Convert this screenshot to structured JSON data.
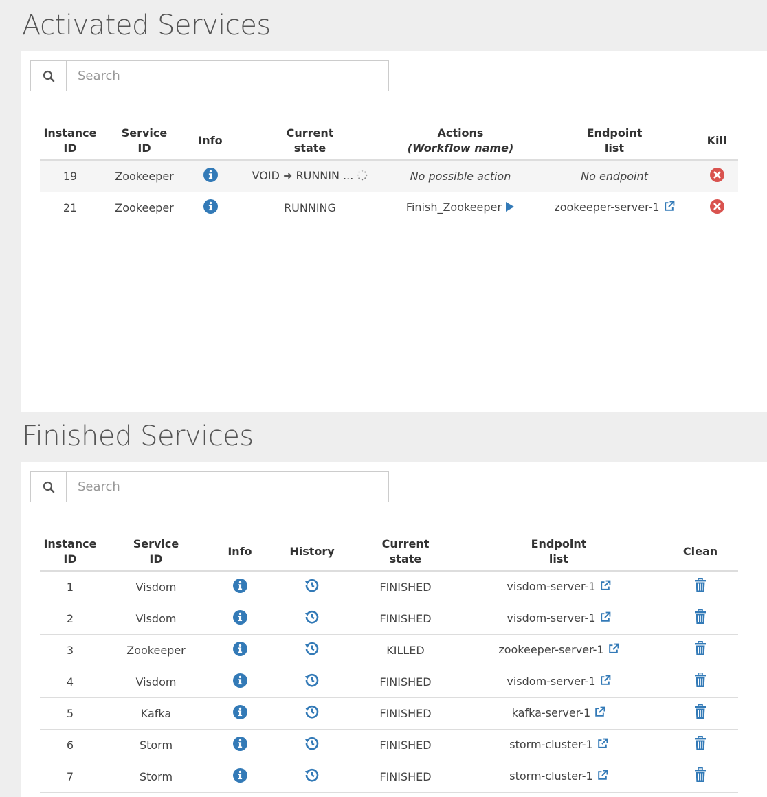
{
  "activated": {
    "title": "Activated Services",
    "search_placeholder": "Search",
    "headers": {
      "instance_1": "Instance",
      "instance_2": "ID",
      "service_1": "Service",
      "service_2": "ID",
      "info": "Info",
      "state_1": "Current",
      "state_2": "state",
      "actions_1": "Actions",
      "actions_2": "(Workflow name)",
      "endpoint_1": "Endpoint",
      "endpoint_2": "list",
      "kill": "Kill"
    },
    "rows": [
      {
        "instance_id": "19",
        "service_id": "Zookeeper",
        "state_from": "VOID",
        "state_arrow": "➜",
        "state_to": "RUNNIN ...",
        "action": "No possible action",
        "endpoint": "No endpoint"
      },
      {
        "instance_id": "21",
        "service_id": "Zookeeper",
        "state": "RUNNING",
        "action": "Finish_Zookeeper",
        "endpoint": "zookeeper-server-1"
      }
    ]
  },
  "finished": {
    "title": "Finished Services",
    "search_placeholder": "Search",
    "headers": {
      "instance_1": "Instance",
      "instance_2": "ID",
      "service_1": "Service",
      "service_2": "ID",
      "info": "Info",
      "history": "History",
      "state_1": "Current",
      "state_2": "state",
      "endpoint_1": "Endpoint",
      "endpoint_2": "list",
      "clean": "Clean"
    },
    "rows": [
      {
        "instance_id": "1",
        "service_id": "Visdom",
        "state": "FINISHED",
        "endpoint": "visdom-server-1"
      },
      {
        "instance_id": "2",
        "service_id": "Visdom",
        "state": "FINISHED",
        "endpoint": "visdom-server-1"
      },
      {
        "instance_id": "3",
        "service_id": "Zookeeper",
        "state": "KILLED",
        "endpoint": "zookeeper-server-1"
      },
      {
        "instance_id": "4",
        "service_id": "Visdom",
        "state": "FINISHED",
        "endpoint": "visdom-server-1"
      },
      {
        "instance_id": "5",
        "service_id": "Kafka",
        "state": "FINISHED",
        "endpoint": "kafka-server-1"
      },
      {
        "instance_id": "6",
        "service_id": "Storm",
        "state": "FINISHED",
        "endpoint": "storm-cluster-1"
      },
      {
        "instance_id": "7",
        "service_id": "Storm",
        "state": "FINISHED",
        "endpoint": "storm-cluster-1"
      }
    ]
  },
  "icons": {
    "search": "search-icon",
    "info": "info-circle-icon",
    "history": "history-icon",
    "external_link": "external-link-icon",
    "kill": "times-circle-icon",
    "clean": "trash-icon",
    "play": "play-icon",
    "spinner": "spinner-icon"
  },
  "colors": {
    "primary": "#337ab7",
    "danger": "#d9534f",
    "text": "#333333",
    "panel_bg": "#ffffff",
    "page_bg": "#eeeeee"
  }
}
